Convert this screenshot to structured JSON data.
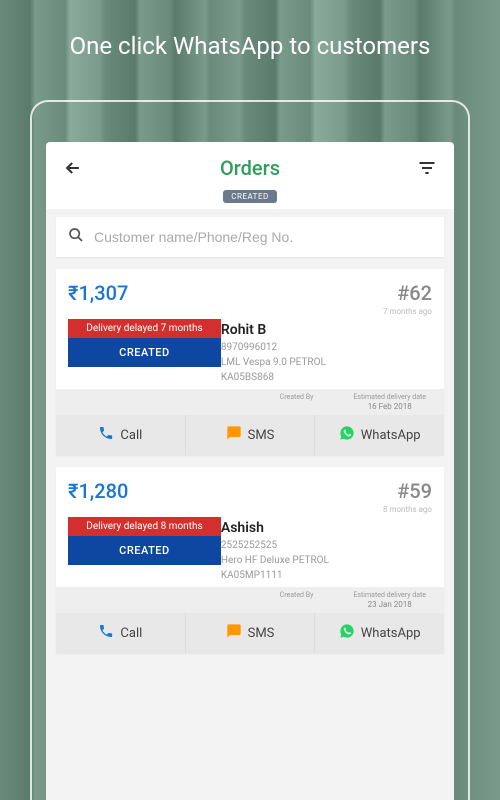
{
  "promo": {
    "title": "One click WhatsApp to customers"
  },
  "appbar": {
    "title": "Orders"
  },
  "filter_chip": "CREATED",
  "search": {
    "placeholder": "Customer name/Phone/Reg No."
  },
  "labels": {
    "created_by": "Created By",
    "est_delivery": "Estimated delivery date",
    "call": "Call",
    "sms": "SMS",
    "whatsapp": "WhatsApp"
  },
  "orders": [
    {
      "amount": "₹1,307",
      "id": "#62",
      "ago": "7 months ago",
      "name": "Rohit B",
      "phone": "8970996012",
      "vehicle": "LML Vespa 9.0 PETROL",
      "reg": "KA05BS868",
      "delay": "Delivery delayed 7 months",
      "status": "CREATED",
      "created_by": "",
      "est_delivery": "16 Feb 2018"
    },
    {
      "amount": "₹1,280",
      "id": "#59",
      "ago": "8 months ago",
      "name": "Ashish",
      "phone": "2525252525",
      "vehicle": "Hero HF Deluxe PETROL",
      "reg": "KA05MP1111",
      "delay": "Delivery delayed 8 months",
      "status": "CREATED",
      "created_by": "",
      "est_delivery": "23 Jan 2018"
    }
  ]
}
